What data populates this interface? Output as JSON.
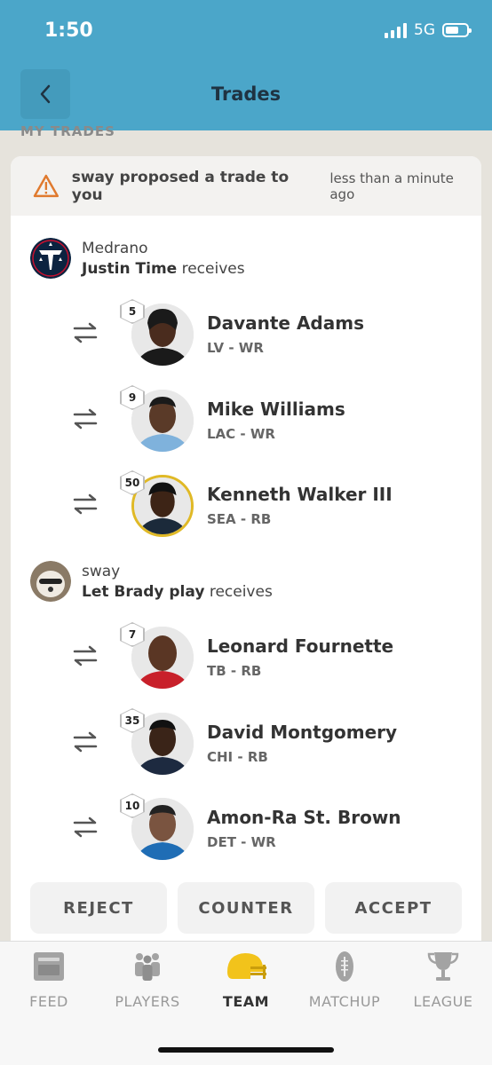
{
  "status": {
    "time": "1:50",
    "network": "5G"
  },
  "header": {
    "title": "Trades"
  },
  "section": {
    "label": "MY TRADES"
  },
  "notice": {
    "message": "sway proposed a trade to you",
    "time_ago": "less than a minute ago"
  },
  "teams": [
    {
      "owner": "Medrano",
      "team_name": "Justin Time",
      "receives": " receives",
      "players": [
        {
          "rank": "5",
          "name": "Davante Adams",
          "pos": "LV - WR"
        },
        {
          "rank": "9",
          "name": "Mike Williams",
          "pos": "LAC - WR"
        },
        {
          "rank": "50",
          "name": "Kenneth Walker III",
          "pos": "SEA - RB"
        }
      ]
    },
    {
      "owner": "sway",
      "team_name": "Let Brady play",
      "receives": " receives",
      "players": [
        {
          "rank": "7",
          "name": "Leonard Fournette",
          "pos": "TB - RB"
        },
        {
          "rank": "35",
          "name": "David Montgomery",
          "pos": "CHI - RB"
        },
        {
          "rank": "10",
          "name": "Amon-Ra St. Brown",
          "pos": "DET - WR"
        }
      ]
    }
  ],
  "actions": {
    "reject": "REJECT",
    "counter": "COUNTER",
    "accept": "ACCEPT"
  },
  "tabs": [
    {
      "label": "FEED",
      "icon": "feed-icon"
    },
    {
      "label": "PLAYERS",
      "icon": "players-icon"
    },
    {
      "label": "TEAM",
      "icon": "helmet-icon"
    },
    {
      "label": "MATCHUP",
      "icon": "football-icon"
    },
    {
      "label": "LEAGUE",
      "icon": "trophy-icon"
    }
  ],
  "colors": {
    "header": "#4ba6c9",
    "warning": "#e07a2e",
    "gold": "#e0b926"
  }
}
